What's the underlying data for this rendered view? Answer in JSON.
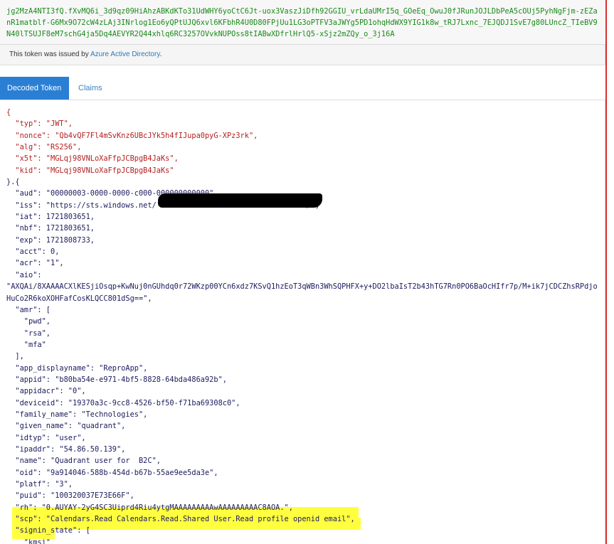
{
  "encoded": {
    "line1": "jg2MzA4NTI3fQ.fXvMQ6i_3d9qz09HiAhzABKdKTo31UdWHY6yoCtC6Jt-uox3VaszJiDfh92GGIU_vrLdaUMrI5q_GOeEq_OwuJ0fJRunJOJLDbPeA5cOUj5PyhNgFjm-zEZa",
    "line2": "nR1matblf-G6Mx9O72cW4zLAj3INrlog1Eo6yQPtUJQ6xvl6KFbhR4U0D80FPjUu1LG3oPTFV3aJWYg5PD1ohqHdWX9YIG1k8w_tRJ7Lxnc_7EJQDJ1SvE7g80LUncZ_TIeBV9",
    "line3": "N40lTSUJF8eM7schG4ja5Dq4AEVYR2Q44xhlq6RC3257OVvkNUPOss8tIABwXDfrlHrlQ5-xSjz2mZQy_o_3j16A"
  },
  "issuer": {
    "prefix": "This token was issued by ",
    "link": "Azure Active Directory",
    "suffix": "."
  },
  "tabs": {
    "decoded": "Decoded Token",
    "claims": "Claims"
  },
  "decoded_lines": [
    {
      "t": "{",
      "c": "punc"
    },
    {
      "t": "  \"typ\": \"JWT\",",
      "c": "hdr"
    },
    {
      "t": "  \"nonce\": \"Qb4vQF7Fl4mSvKnz6UBcJYk5h4fIJupa0pyG-XPz3rk\",",
      "c": "hdr"
    },
    {
      "t": "  \"alg\": \"RS256\",",
      "c": "hdr"
    },
    {
      "t": "  \"x5t\": \"MGLqj98VNLoXaFfpJCBpgB4JaKs\",",
      "c": "hdr"
    },
    {
      "t": "  \"kid\": \"MGLqj98VNLoXaFfpJCBpgB4JaKs\"",
      "c": "hdr"
    },
    {
      "t": "}.{",
      "c": "pay"
    },
    {
      "t": "  \"aud\": \"00000003-0000-0000-c000-000000000000\",",
      "c": "pay"
    },
    {
      "t": "  \"iss\": \"https://sts.windows.net/                                  /\",",
      "c": "pay"
    },
    {
      "t": "  \"iat\": 1721803651,",
      "c": "pay"
    },
    {
      "t": "  \"nbf\": 1721803651,",
      "c": "pay"
    },
    {
      "t": "  \"exp\": 1721808733,",
      "c": "pay"
    },
    {
      "t": "  \"acct\": 0,",
      "c": "pay"
    },
    {
      "t": "  \"acr\": \"1\",",
      "c": "pay"
    },
    {
      "t": "  \"aio\":",
      "c": "pay"
    },
    {
      "t": "\"AXQAi/8XAAAACXlKESjiOsqp+KwNuj0nGUhdq0r72WKzp00YCn6xdz7KSvQ1hzEoT3qWBn3WhSQPHFX+y+DO2lbaIsT2b43hTG7Rn0PO6BaOcHIfr7p/M+ik7jCDCZhsRPdjo",
      "c": "pay"
    },
    {
      "t": "HuCo2R6koXOHFafCosKLQCC801dSg==\",",
      "c": "pay"
    },
    {
      "t": "  \"amr\": [",
      "c": "pay"
    },
    {
      "t": "    \"pwd\",",
      "c": "pay"
    },
    {
      "t": "    \"rsa\",",
      "c": "pay"
    },
    {
      "t": "    \"mfa\"",
      "c": "pay"
    },
    {
      "t": "  ],",
      "c": "pay"
    },
    {
      "t": "  \"app_displayname\": \"ReproApp\",",
      "c": "pay"
    },
    {
      "t": "  \"appid\": \"b80ba54e-e971-4bf5-8828-64bda486a92b\",",
      "c": "pay"
    },
    {
      "t": "  \"appidacr\": \"0\",",
      "c": "pay"
    },
    {
      "t": "  \"deviceid\": \"19370a3c-9cc8-4526-bf50-f71ba69308c0\",",
      "c": "pay"
    },
    {
      "t": "  \"family_name\": \"Technologies\",",
      "c": "pay"
    },
    {
      "t": "  \"given_name\": \"quadrant\",",
      "c": "pay"
    },
    {
      "t": "  \"idtyp\": \"user\",",
      "c": "pay"
    },
    {
      "t": "  \"ipaddr\": \"54.86.50.139\",",
      "c": "pay"
    },
    {
      "t": "  \"name\": \"Quadrant user for  B2C\",",
      "c": "pay"
    },
    {
      "t": "  \"oid\": \"9a914046-588b-454d-b67b-55ae9ee5da3e\",",
      "c": "pay"
    },
    {
      "t": "  \"platf\": \"3\",",
      "c": "pay"
    },
    {
      "t": "  \"puid\": \"100320037E73E66F\",",
      "c": "pay"
    },
    {
      "t": "  \"rh\": \"0.AUYAY-2yG4SC3Uiprd4Riu4ytgMAAAAAAAAAwAAAAAAAAAC8AOA.\",",
      "c": "pay"
    },
    {
      "t": "  \"scp\": \"Calendars.Read Calendars.Read.Shared User.Read profile openid email\",",
      "c": "pay"
    },
    {
      "t": "  \"signin_state\": [",
      "c": "pay"
    },
    {
      "t": "    \"kmsi\"",
      "c": "pay"
    }
  ]
}
